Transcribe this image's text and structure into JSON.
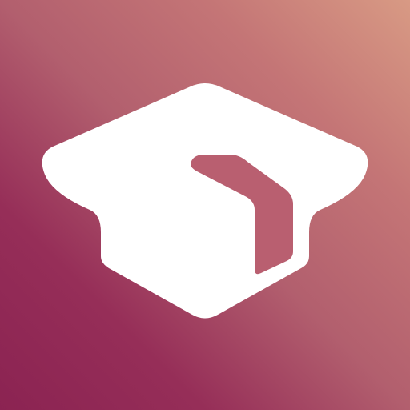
{
  "icon": {
    "name": "graduation-cap-icon",
    "background_gradient": [
      "#D89A84",
      "#C47576",
      "#B25F6E",
      "#962E58",
      "#8B2352"
    ],
    "glyph_color": "#FFFFFF",
    "tassel_color": "#B95F70"
  }
}
